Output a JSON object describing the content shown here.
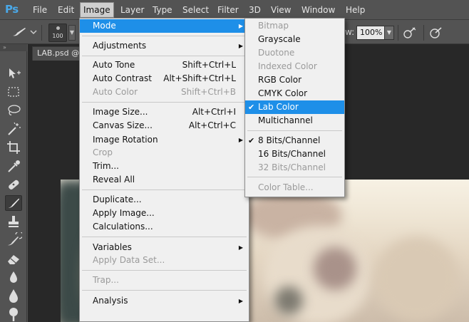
{
  "app": {
    "logo": "Ps"
  },
  "menubar": {
    "items": [
      "File",
      "Edit",
      "Image",
      "Layer",
      "Type",
      "Select",
      "Filter",
      "3D",
      "View",
      "Window",
      "Help"
    ],
    "active": "Image"
  },
  "options": {
    "brush_size": "100",
    "flow_label": "w:",
    "flow_value": "100%"
  },
  "document": {
    "tab_label": "LAB.psd @"
  },
  "image_menu": {
    "mode": "Mode",
    "adjustments": "Adjustments",
    "auto_tone": "Auto Tone",
    "auto_tone_sc": "Shift+Ctrl+L",
    "auto_contrast": "Auto Contrast",
    "auto_contrast_sc": "Alt+Shift+Ctrl+L",
    "auto_color": "Auto Color",
    "auto_color_sc": "Shift+Ctrl+B",
    "image_size": "Image Size...",
    "image_size_sc": "Alt+Ctrl+I",
    "canvas_size": "Canvas Size...",
    "canvas_size_sc": "Alt+Ctrl+C",
    "image_rotation": "Image Rotation",
    "crop": "Crop",
    "trim": "Trim...",
    "reveal_all": "Reveal All",
    "duplicate": "Duplicate...",
    "apply_image": "Apply Image...",
    "calculations": "Calculations...",
    "variables": "Variables",
    "apply_data_set": "Apply Data Set...",
    "trap": "Trap...",
    "analysis": "Analysis"
  },
  "mode_menu": {
    "bitmap": "Bitmap",
    "grayscale": "Grayscale",
    "duotone": "Duotone",
    "indexed_color": "Indexed Color",
    "rgb_color": "RGB Color",
    "cmyk_color": "CMYK Color",
    "lab_color": "Lab Color",
    "multichannel": "Multichannel",
    "bits8": "8 Bits/Channel",
    "bits16": "16 Bits/Channel",
    "bits32": "32 Bits/Channel",
    "color_table": "Color Table..."
  },
  "colors": {
    "highlight": "#1e8fe8",
    "logo": "#4aa8e8"
  }
}
